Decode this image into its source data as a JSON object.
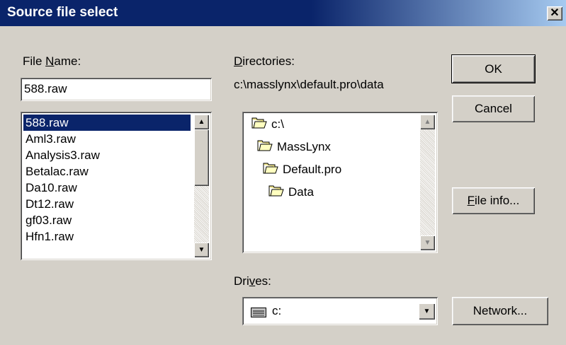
{
  "dialog": {
    "title": "Source file select",
    "close_glyph": "✕"
  },
  "filename": {
    "label_prefix": "File ",
    "label_hot": "N",
    "label_suffix": "ame:",
    "value": "588.raw"
  },
  "files": [
    "588.raw",
    "Aml3.raw",
    "Analysis3.raw",
    "Betalac.raw",
    "Da10.raw",
    "Dt12.raw",
    "gf03.raw",
    "Hfn1.raw"
  ],
  "directories": {
    "label_hot": "D",
    "label_rest": "irectories:",
    "path": "c:\\masslynx\\default.pro\\data",
    "tree": [
      {
        "label": "c:\\",
        "icon": "open-folder-icon"
      },
      {
        "label": "MassLynx",
        "icon": "open-folder-icon"
      },
      {
        "label": "Default.pro",
        "icon": "open-folder-icon"
      },
      {
        "label": "Data",
        "icon": "open-folder-icon"
      }
    ]
  },
  "drives": {
    "label_prefix": "Dri",
    "label_hot": "v",
    "label_suffix": "es:",
    "value": "c:",
    "icon": "drive-icon"
  },
  "buttons": {
    "ok": "OK",
    "cancel": "Cancel",
    "fileinfo_hot": "F",
    "fileinfo_rest": "ile info...",
    "network": "Network..."
  },
  "scroll_glyphs": {
    "up": "▲",
    "down": "▼"
  }
}
